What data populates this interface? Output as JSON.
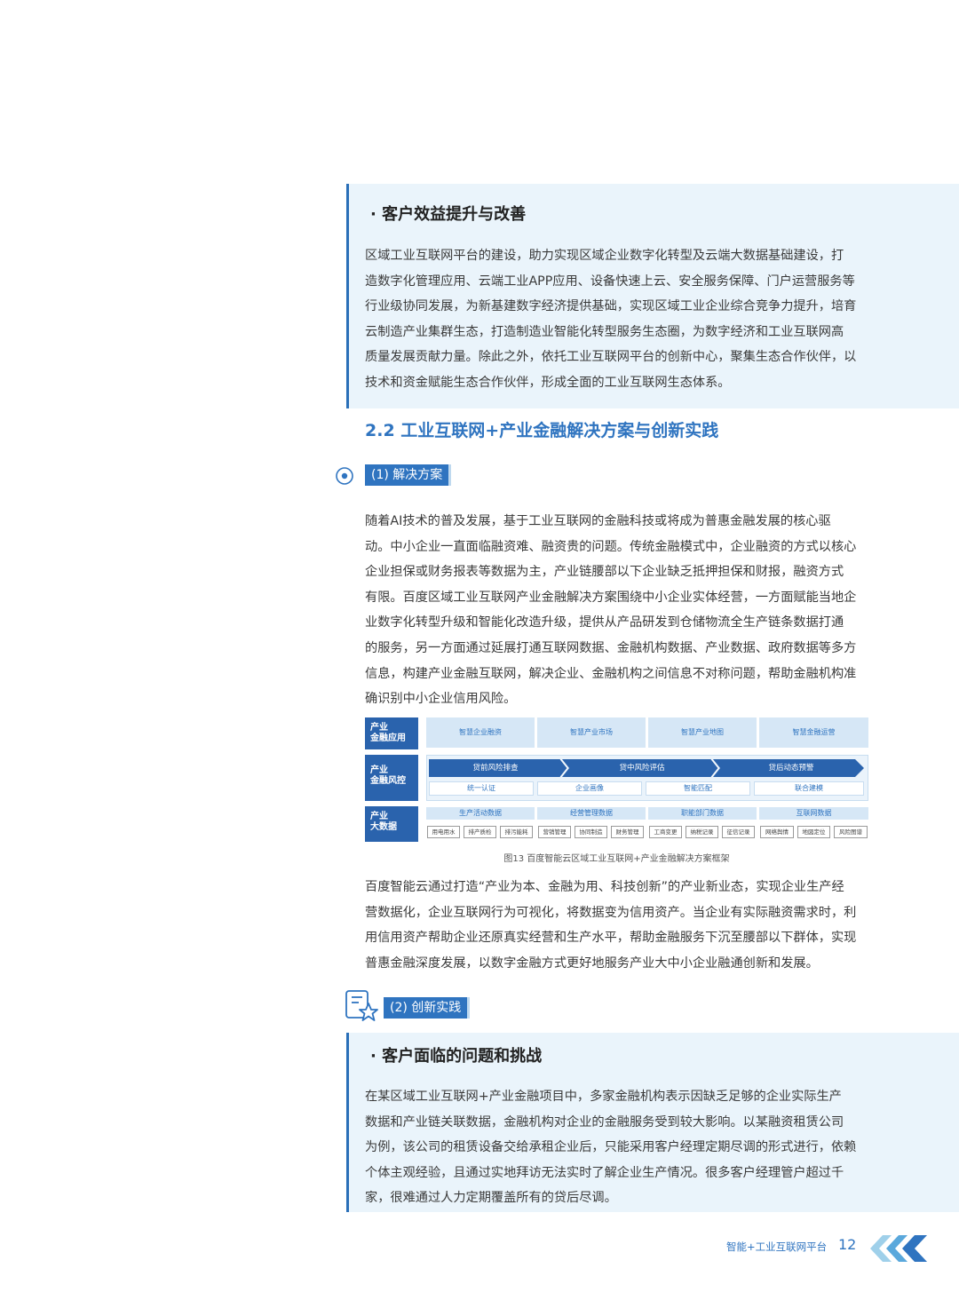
{
  "panel1": {
    "heading": "· 客户效益提升与改善",
    "lines": [
      "区域工业互联网平台的建设，助力实现区域企业数字化转型及云端大数据基础建设，打",
      "造数字化管理应用、云端工业APP应用、设备快速上云、安全服务保障、门户运营服务等",
      "行业级协同发展，为新基建数字经济提供基础，实现区域工业企业综合竞争力提升，培育",
      "云制造产业集群生态，打造制造业智能化转型服务生态圈，为数字经济和工业互联网高",
      "质量发展贡献力量。除此之外，依托工业互联网平台的创新中心，聚集生态合作伙伴，以",
      "技术和资金赋能生态合作伙伴，形成全面的工业互联网生态体系。"
    ]
  },
  "section": {
    "title": "2.2  工业互联网+产业金融解决方案与创新实践"
  },
  "sub1": {
    "label": "(1) 解决方案",
    "lines": [
      "随着AI技术的普及发展，基于工业互联网的金融科技或将成为普惠金融发展的核心驱",
      "动。中小企业一直面临融资难、融资贵的问题。传统金融模式中，企业融资的方式以核心",
      "企业担保或财务报表等数据为主，产业链腰部以下企业缺乏抵押担保和财报，融资方式",
      "有限。百度区域工业互联网产业金融解决方案围绕中小企业实体经营，一方面赋能当地企",
      "业数字化转型升级和智能化改造升级，提供从产品研发到仓储物流全生产链条数据打通",
      "的服务，另一方面通过延展打通互联网数据、金融机构数据、产业数据、政府数据等多方",
      "信息，构建产业金融互联网，解决企业、金融机构之间信息不对称问题，帮助金融机构准",
      "确识别中小企业信用风险。"
    ]
  },
  "diagram": {
    "row1": {
      "label_a": "产业",
      "label_b": "金融应用",
      "cells": [
        "智慧企业融资",
        "智慧产业市场",
        "智慧产业地图",
        "智慧金融运营"
      ]
    },
    "row2": {
      "label_a": "产业",
      "label_b": "金融风控",
      "arrows": [
        "贷前风险排查",
        "贷中风险评估",
        "贷后动态预警"
      ],
      "cells": [
        "统一认证",
        "企业画像",
        "智能匹配",
        "联合建模"
      ]
    },
    "row3": {
      "label_a": "产业",
      "label_b": "大数据",
      "groups": [
        {
          "title": "生产活动数据",
          "items": [
            "用电用水",
            "排产质检",
            "排污能耗"
          ]
        },
        {
          "title": "经营管理数据",
          "items": [
            "营销管理",
            "协同制造",
            "财务管理"
          ]
        },
        {
          "title": "职能部门数据",
          "items": [
            "工商变更",
            "纳税记录",
            "征信记录"
          ]
        },
        {
          "title": "互联网数据",
          "items": [
            "网络舆情",
            "地図定位",
            "风险图谱"
          ]
        }
      ]
    },
    "caption": "图13 百度智能云区域工业互联网+产业金融解决方案框架"
  },
  "para2": {
    "lines": [
      "百度智能云通过打造“产业为本、金融为用、科技创新”的产业新业态，实现企业生产经",
      "营数据化，企业互联网行为可视化，将数据变为信用资产。当企业有实际融资需求时，利",
      "用信用资产帮助企业还原真实经营和生产水平，帮助金融服务下沉至腰部以下群体，实现",
      "普惠金融深度发展，以数字金融方式更好地服务产业大中小企业融通创新和发展。"
    ]
  },
  "sub2": {
    "label": "(2) 创新实践"
  },
  "panel2": {
    "heading": "· 客户面临的问题和挑战",
    "lines": [
      "在某区域工业互联网+产业金融项目中，多家金融机构表示因缺乏足够的企业实际生产",
      "数据和产业链关联数据，金融机构对企业的金融服务受到较大影响。以某融资租赁公司",
      "为例，该公司的租赁设备交给承租企业后，只能采用客户经理定期尽调的形式进行，依赖",
      "个体主观经验，且通过实地拜访无法实时了解企业生产情况。很多客户经理管户超过千",
      "家，很难通过人力定期覆盖所有的贷后尽调。"
    ]
  },
  "footer": {
    "text": "智能+工业互联网平台",
    "page": "12"
  },
  "colors": {
    "accent": "#2f74c0",
    "panel_bg": "#eaf4fb",
    "label_bg": "#2a63ad"
  }
}
